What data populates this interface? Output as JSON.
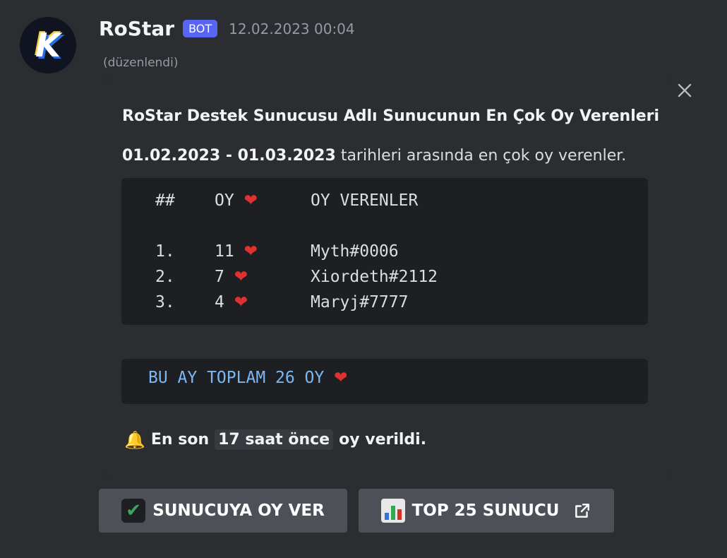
{
  "message": {
    "username": "RoStar",
    "badge": "BOT",
    "timestamp": "12.02.2023 00:04",
    "edited": "(düzenlendi)",
    "avatar_letter": "K"
  },
  "embed": {
    "title": "RoStar Destek Sunucusu Adlı Sunucunun En Çok Oy Verenleri",
    "date_range": "01.02.2023 - 01.03.2023",
    "description_rest": "tarihleri arasında en çok oy verenler.",
    "table": {
      "headers": [
        "##",
        "OY",
        "OY VERENLER"
      ],
      "rows": [
        {
          "rank": "1.",
          "votes": "11",
          "user": "Myth#0006"
        },
        {
          "rank": "2.",
          "votes": "7",
          "user": "Xiordeth#2112"
        },
        {
          "rank": "3.",
          "votes": "4",
          "user": "Maryj#7777"
        }
      ]
    },
    "total": "BU AY TOPLAM 26 OY",
    "footer_prefix": "En son",
    "footer_code": "17 saat önce",
    "footer_suffix": "oy verildi."
  },
  "buttons": {
    "vote_label": "SUNUCUYA OY VER",
    "top_label": "TOP 25 SUNUCU"
  },
  "colors": {
    "background": "#2b2d31",
    "codeblock": "#1e1f22",
    "badge": "#5865f2",
    "button": "#4e5058",
    "total_text": "#7ab8f5",
    "heart": "#e03131"
  },
  "icons": {
    "heart": "heart-icon",
    "bell": "bell-icon",
    "check": "check-icon",
    "chart": "bar-chart-icon",
    "external": "external-link-icon",
    "close": "close-icon"
  }
}
